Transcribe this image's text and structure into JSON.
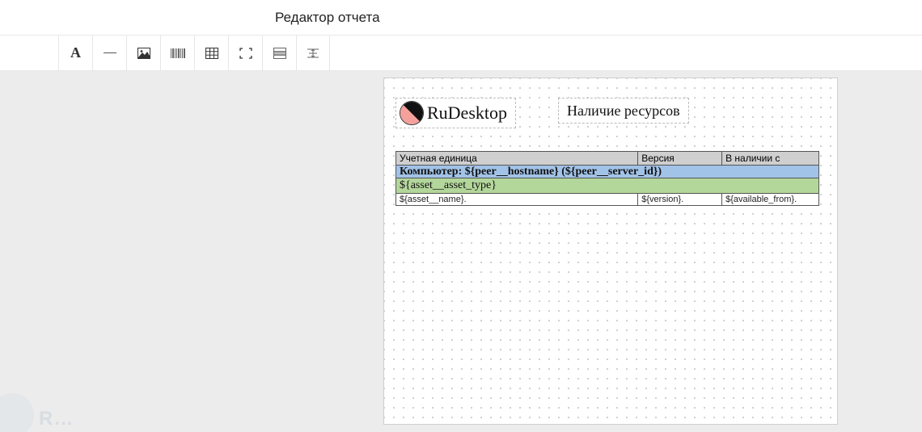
{
  "window": {
    "title": "Редактор отчета"
  },
  "toolbar": {
    "tools": [
      {
        "name": "text-tool",
        "icon": "text-icon"
      },
      {
        "name": "line-tool",
        "icon": "line-icon"
      },
      {
        "name": "image-tool",
        "icon": "image-icon"
      },
      {
        "name": "barcode-tool",
        "icon": "barcode-icon"
      },
      {
        "name": "table-tool",
        "icon": "table-icon"
      },
      {
        "name": "bounds-tool",
        "icon": "bounds-icon"
      },
      {
        "name": "row-tool",
        "icon": "row-icon"
      },
      {
        "name": "spacer-tool",
        "icon": "spacer-icon"
      }
    ]
  },
  "canvas": {
    "brand": "RuDesktop",
    "report_title": "Наличие ресурсов",
    "table": {
      "headers": [
        "Учетная единица",
        "Версия",
        "В наличии с"
      ],
      "group_row": "Компьютер: ${peer__hostname} (${peer__server_id})",
      "subgroup_row": "${asset__asset_type}",
      "data_row": [
        "${asset__name}.",
        "${version}.",
        "${available_from}."
      ]
    }
  },
  "watermark": {
    "text": "R…"
  }
}
